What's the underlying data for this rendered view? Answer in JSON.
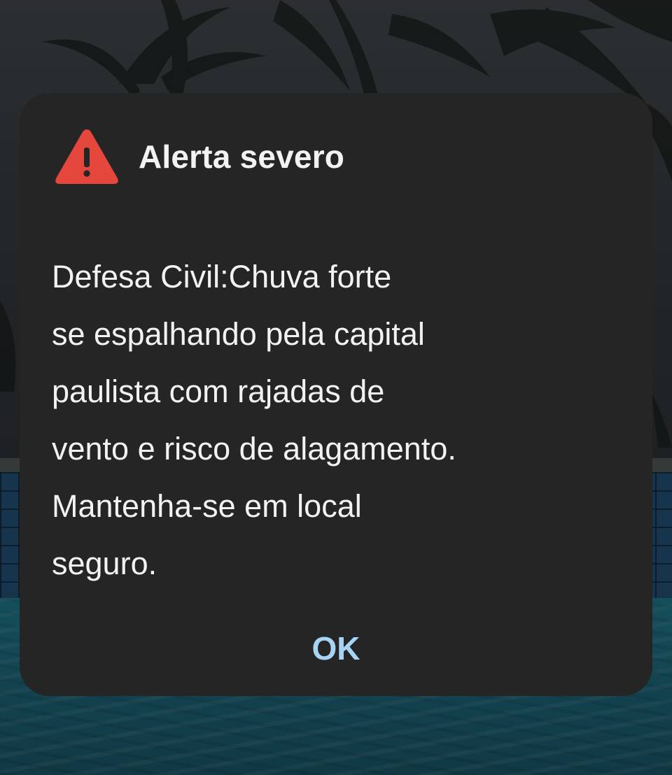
{
  "alert": {
    "title": "Alerta severo",
    "icon": "warning-triangle-icon",
    "icon_color": "#e5473c",
    "message_lines": [
      "Defesa Civil:Chuva forte",
      "se espalhando pela capital",
      "paulista com rajadas de",
      "vento e risco de alagamento.",
      "Mantenha-se em local",
      "seguro."
    ],
    "ok_label": "OK",
    "ok_color": "#a8d4f4",
    "background_color": "#252526"
  }
}
